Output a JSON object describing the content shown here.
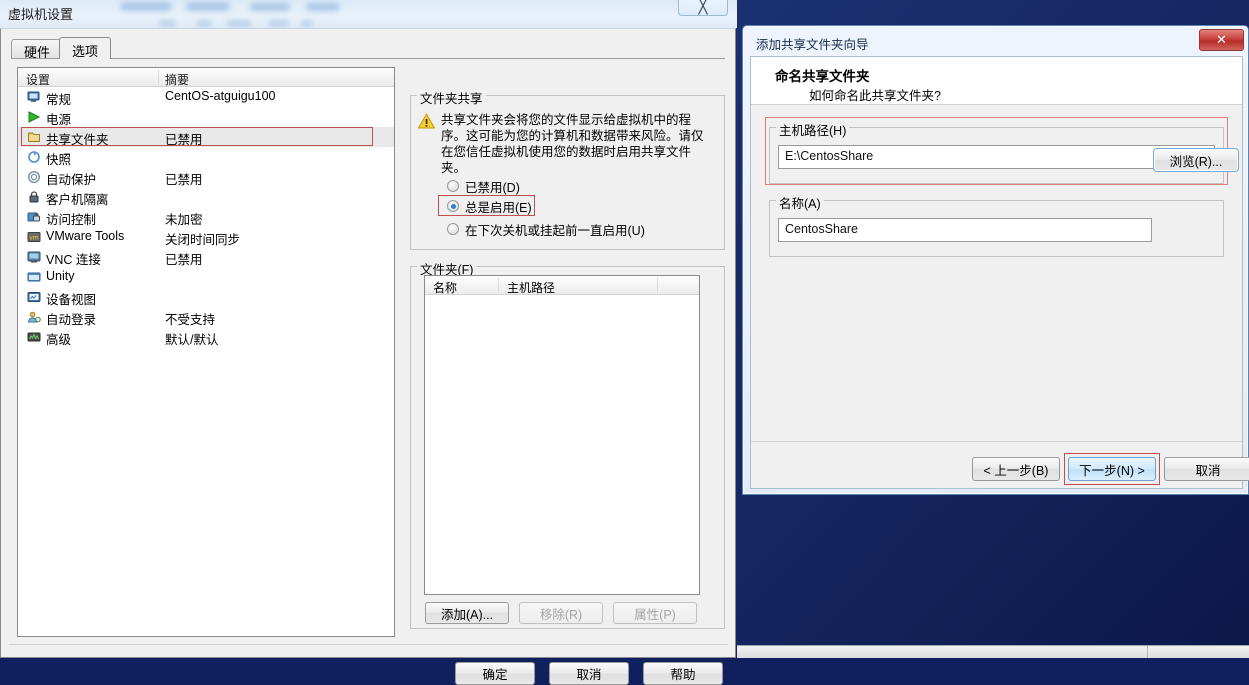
{
  "vm_dialog": {
    "title": "虚拟机设置",
    "close_icon": "close-icon",
    "tabs": [
      {
        "label": "硬件",
        "active": false
      },
      {
        "label": "选项",
        "active": true
      }
    ],
    "list_headers": {
      "setting": "设置",
      "summary": "摘要"
    },
    "settings": [
      {
        "icon": "monitor-icon",
        "name": "常规",
        "summary": "CentOS-atguigu100"
      },
      {
        "icon": "power-icon",
        "name": "电源",
        "summary": ""
      },
      {
        "icon": "folder-icon",
        "name": "共享文件夹",
        "summary": "已禁用"
      },
      {
        "icon": "snapshot-icon",
        "name": "快照",
        "summary": ""
      },
      {
        "icon": "autoprotect-icon",
        "name": "自动保护",
        "summary": "已禁用"
      },
      {
        "icon": "lock-icon",
        "name": "客户机隔离",
        "summary": ""
      },
      {
        "icon": "access-control-icon",
        "name": "访问控制",
        "summary": "未加密"
      },
      {
        "icon": "vmware-tools-icon",
        "name": "VMware Tools",
        "summary": "关闭时间同步"
      },
      {
        "icon": "vnc-icon",
        "name": "VNC 连接",
        "summary": "已禁用"
      },
      {
        "icon": "unity-icon",
        "name": "Unity",
        "summary": ""
      },
      {
        "icon": "device-view-icon",
        "name": "设备视图",
        "summary": ""
      },
      {
        "icon": "autologin-icon",
        "name": "自动登录",
        "summary": "不受支持"
      },
      {
        "icon": "advanced-icon",
        "name": "高级",
        "summary": "默认/默认"
      }
    ],
    "folder_sharing": {
      "group_label": "文件夹共享",
      "warning_icon": "warning-icon",
      "warning_text": "共享文件夹会将您的文件显示给虚拟机中的程序。这可能为您的计算机和数据带来风险。请仅在您信任虚拟机使用您的数据时启用共享文件夹。",
      "options": [
        {
          "label": "已禁用(D)",
          "selected": false
        },
        {
          "label": "总是启用(E)",
          "selected": true
        },
        {
          "label": "在下次关机或挂起前一直启用(U)",
          "selected": false
        }
      ]
    },
    "folders": {
      "group_label": "文件夹(F)",
      "columns": [
        "名称",
        "主机路径"
      ],
      "rows": [],
      "buttons": [
        {
          "label": "添加(A)...",
          "enabled": true
        },
        {
          "label": "移除(R)",
          "enabled": false
        },
        {
          "label": "属性(P)",
          "enabled": false
        }
      ]
    },
    "footer_buttons": [
      {
        "label": "确定"
      },
      {
        "label": "取消"
      },
      {
        "label": "帮助"
      }
    ]
  },
  "wizard": {
    "title": "添加共享文件夹向导",
    "close_icon": "close-icon",
    "heading": "命名共享文件夹",
    "subheading": "如何命名此共享文件夹?",
    "host_path": {
      "label": "主机路径(H)",
      "value": "E:\\CentosShare"
    },
    "browse_button": "浏览(R)...",
    "name": {
      "label": "名称(A)",
      "value": "CentosShare"
    },
    "footer_buttons": [
      {
        "label": "< 上一步(B)",
        "highlighted": false
      },
      {
        "label": "下一步(N) >",
        "highlighted": true
      },
      {
        "label": "取消",
        "highlighted": false
      }
    ]
  },
  "colors": {
    "accent_red": "#c0504d",
    "desktop_blue": "#15265f",
    "selection_gray": "#e8e8e8"
  }
}
